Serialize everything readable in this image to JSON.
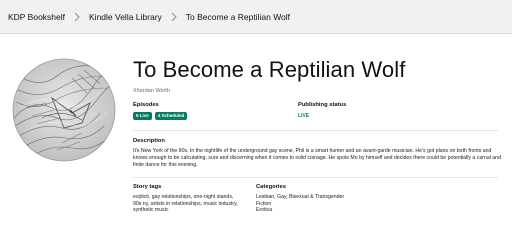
{
  "breadcrumb": {
    "items": [
      "KDP Bookshelf",
      "Kindle Vella Library",
      "To Become a Reptilian Wolf"
    ]
  },
  "cover": {
    "description_icon": "wolf-cover-art"
  },
  "story": {
    "title": "To Become a Reptilian Wolf",
    "author": "Xherdan Werth",
    "episodes_label": "Episodes",
    "badges": [
      "6 Live",
      "4 Scheduled"
    ],
    "publishing_status_label": "Publishing status",
    "publishing_status": "LIVE",
    "description_label": "Description",
    "description": "It's New York of the 90s. In the nightlife of the underground gay scene, Phil is a smart hunter and an avant-garde musician. He's got plans on both fronts and knows enough to be calculating, sure and discerning when it comes to solid coinage. He spots Mo by himself and decides there could be potentially a carnal and finite dance for this evening.",
    "story_tags_label": "Story tags",
    "story_tags": "explicit, gay relationships, one-night stands, 90s ny, artists in relationships, music industry, synthetic music",
    "categories_label": "Categories",
    "categories": [
      "Lesbian, Gay, Bisexual & Transgender",
      "Fiction",
      "Erotica"
    ]
  },
  "colors": {
    "badge_green": "#067d62",
    "breadcrumb_bg": "#f0f2f2"
  }
}
